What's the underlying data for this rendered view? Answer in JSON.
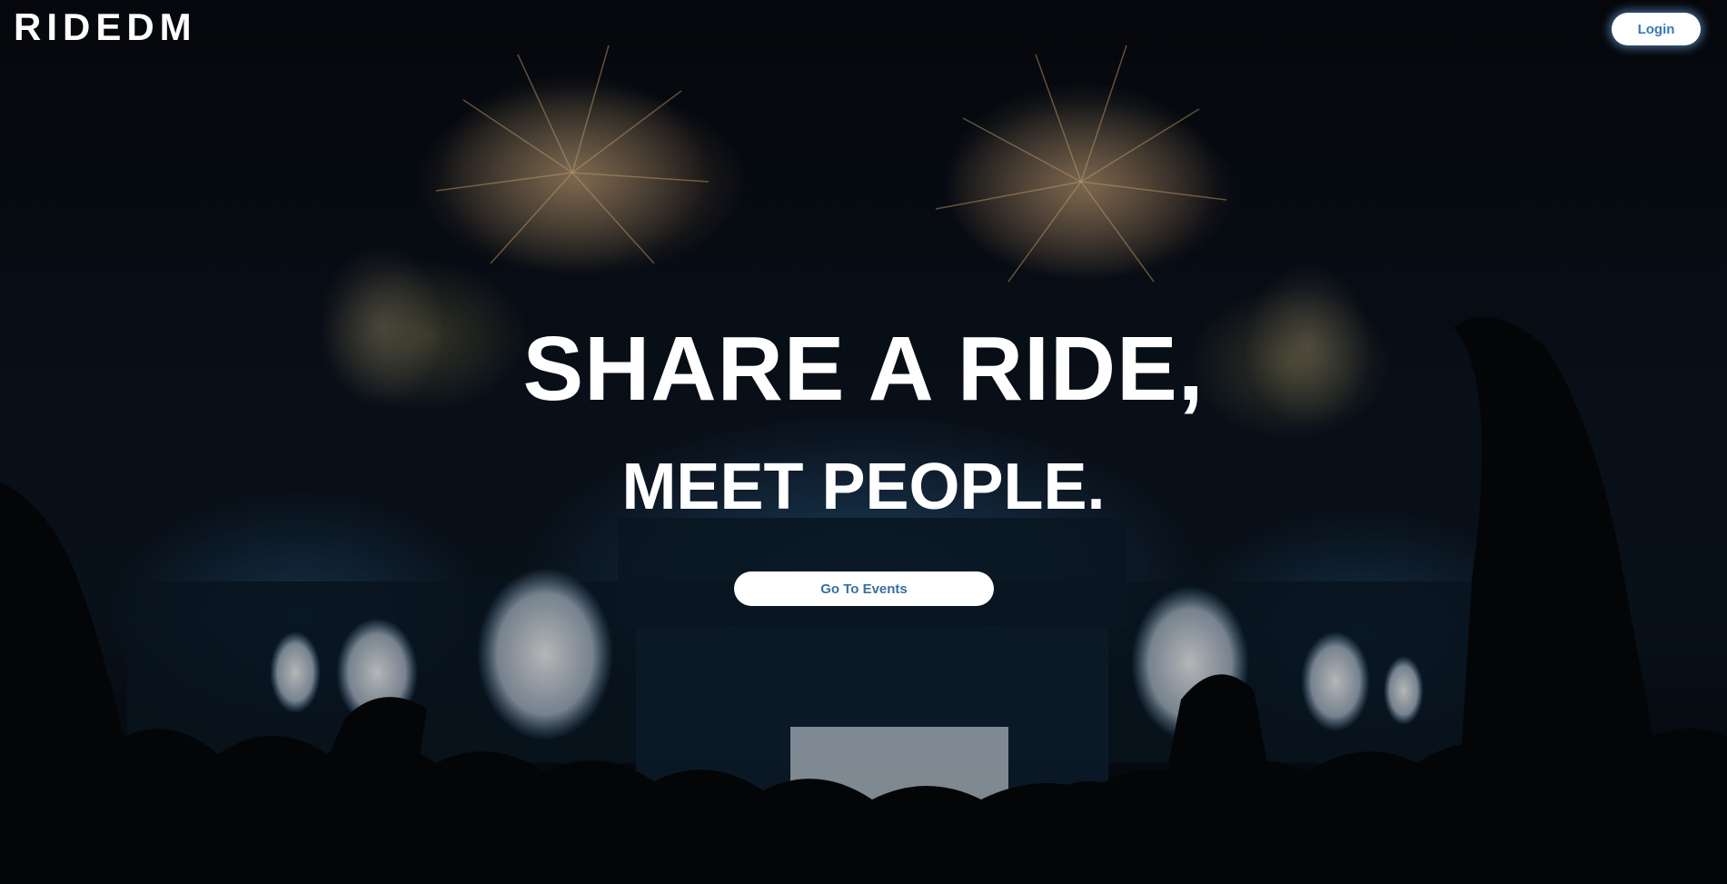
{
  "header": {
    "logo_text": "RIDEDM",
    "login_label": "Login"
  },
  "hero": {
    "headline_line1": "SHARE A RIDE,",
    "headline_line2": "MEET PEOPLE.",
    "cta_label": "Go To Events",
    "background_description_icon": "concert-fireworks-image"
  },
  "colors": {
    "text": "#ffffff",
    "button_background": "#ffffff",
    "button_text": "#3a78b8",
    "login_glow": "#78b4ff"
  }
}
